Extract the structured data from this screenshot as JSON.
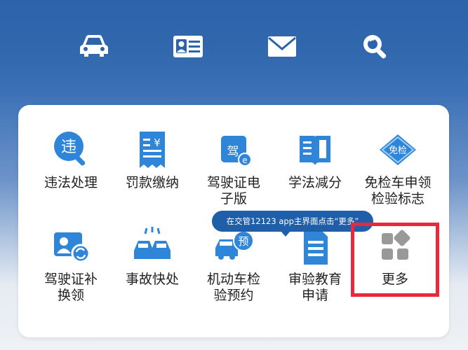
{
  "top_icons": [
    {
      "name": "car-icon"
    },
    {
      "name": "id-card-icon"
    },
    {
      "name": "mail-icon"
    },
    {
      "name": "search-icon"
    }
  ],
  "row1": [
    {
      "label": "违法处理",
      "icon": "violation-icon"
    },
    {
      "label": "罚款缴纳",
      "icon": "fine-payment-icon"
    },
    {
      "label": "驾驶证电\n子版",
      "icon": "e-license-icon"
    },
    {
      "label": "学法减分",
      "icon": "study-book-icon"
    },
    {
      "label": "免检车申领\n检验标志",
      "icon": "inspection-exempt-icon"
    }
  ],
  "row2": [
    {
      "label": "驾驶证补\n换领",
      "icon": "license-replace-icon"
    },
    {
      "label": "事故快处",
      "icon": "accident-icon"
    },
    {
      "label": "机动车检\n验预约",
      "icon": "vehicle-inspection-icon"
    },
    {
      "label": "审验教育\n申请",
      "icon": "review-education-icon"
    },
    {
      "label": "更多",
      "icon": "more-grid-icon"
    }
  ],
  "icon_badges": {
    "violation": "违",
    "e_license": "驾",
    "e_license_small": "e",
    "inspection_exempt": "免检",
    "vehicle_inspection": "预",
    "fine_symbol": "¥"
  },
  "tooltip": {
    "text": "在交管12123 app主界面点击“更多”"
  },
  "colors": {
    "brand_blue": "#2d63aa",
    "icon_blue": "#2f86d8",
    "highlight_red": "#e8283c"
  }
}
